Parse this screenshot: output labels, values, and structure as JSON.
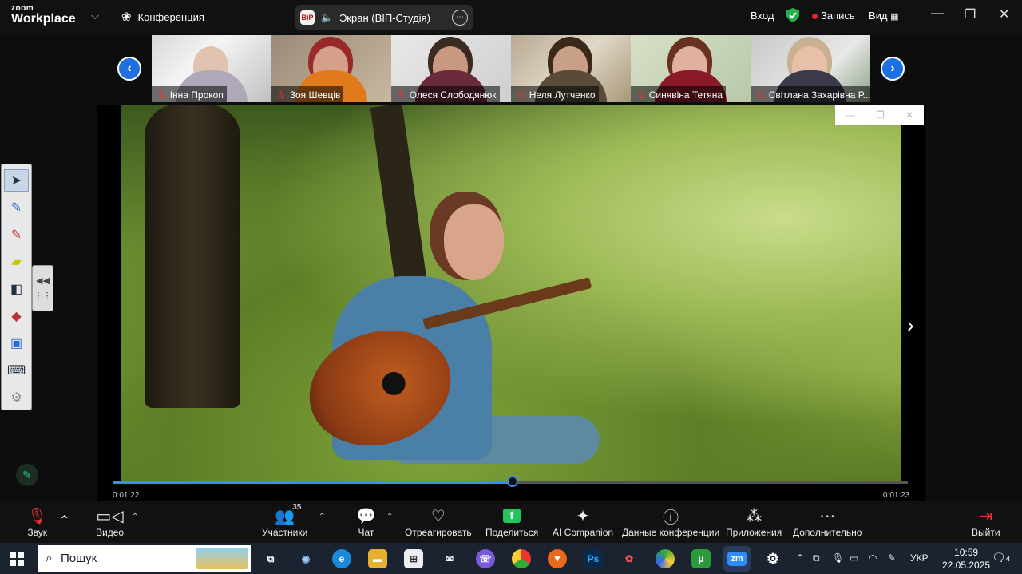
{
  "topbar": {
    "logo_top": "zoom",
    "logo_bottom": "Workplace",
    "meeting_label": "Конференция",
    "screen_share_label": "Экран (ВІП-Студія)",
    "screen_app_badge": "BiP",
    "signin_label": "Вход",
    "record_label": "Запись",
    "view_label": "Вид",
    "colors": {
      "record_dot": "#e02828",
      "shield": "#22b14c"
    }
  },
  "participants": [
    {
      "name": "Інна Прокоп",
      "muted": true
    },
    {
      "name": "Зоя Шевців",
      "muted": true
    },
    {
      "name": "Олеся Слободянюк",
      "muted": true
    },
    {
      "name": "Неля Лутченко",
      "muted": true
    },
    {
      "name": "Синявіна Тетяна",
      "muted": true
    },
    {
      "name": "Світлана Захарівна Р...",
      "muted": true
    }
  ],
  "video": {
    "progress": 0.503,
    "time_elapsed": "0:01:22",
    "time_total": "0:01:23"
  },
  "toolbar": {
    "audio": "Звук",
    "video": "Видео",
    "participants": "Участники",
    "participants_count": "35",
    "chat": "Чат",
    "react": "Отреагировать",
    "share": "Поделиться",
    "ai": "AI Companion",
    "info": "Данные конференции",
    "apps": "Приложения",
    "more": "Дополнительно",
    "leave": "Выйти",
    "colors": {
      "share_green": "#22c55e",
      "leave_red": "#e02828"
    }
  },
  "taskbar": {
    "search_placeholder": "Пошук",
    "lang": "УКР",
    "time": "10:59",
    "date": "22.05.2025",
    "notifications": "4"
  }
}
